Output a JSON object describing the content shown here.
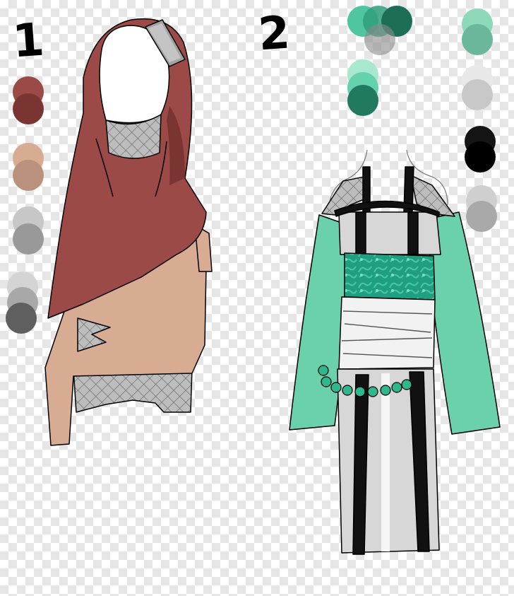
{
  "labels": {
    "outfit_1": "1",
    "outfit_2": "2"
  },
  "palette_1": {
    "red": [
      "#9c4a47",
      "#7a3533"
    ],
    "skin": [
      "#d8ab93",
      "#b9917c"
    ],
    "gray": [
      "#c7c7c7",
      "#999999"
    ],
    "dark": [
      "#d4d4d4",
      "#a8a8a8",
      "#777777",
      "#555555"
    ]
  },
  "palette_2": {
    "green_top": [
      "#4fc6a0",
      "#2f9e7c",
      "#1d6e57",
      "#8a8a8a"
    ],
    "green_mid": [
      "#a7e8cf",
      "#66d1ad",
      "#3aa385",
      "#217a5f"
    ],
    "mint": [
      "#8fd9bb",
      "#6bb79b"
    ],
    "light": [
      "#e8e8e8",
      "#c8c8c8"
    ],
    "black": [
      "#151515",
      "#000000"
    ],
    "silver": [
      "#cfcfcf",
      "#a9a9a9"
    ]
  }
}
